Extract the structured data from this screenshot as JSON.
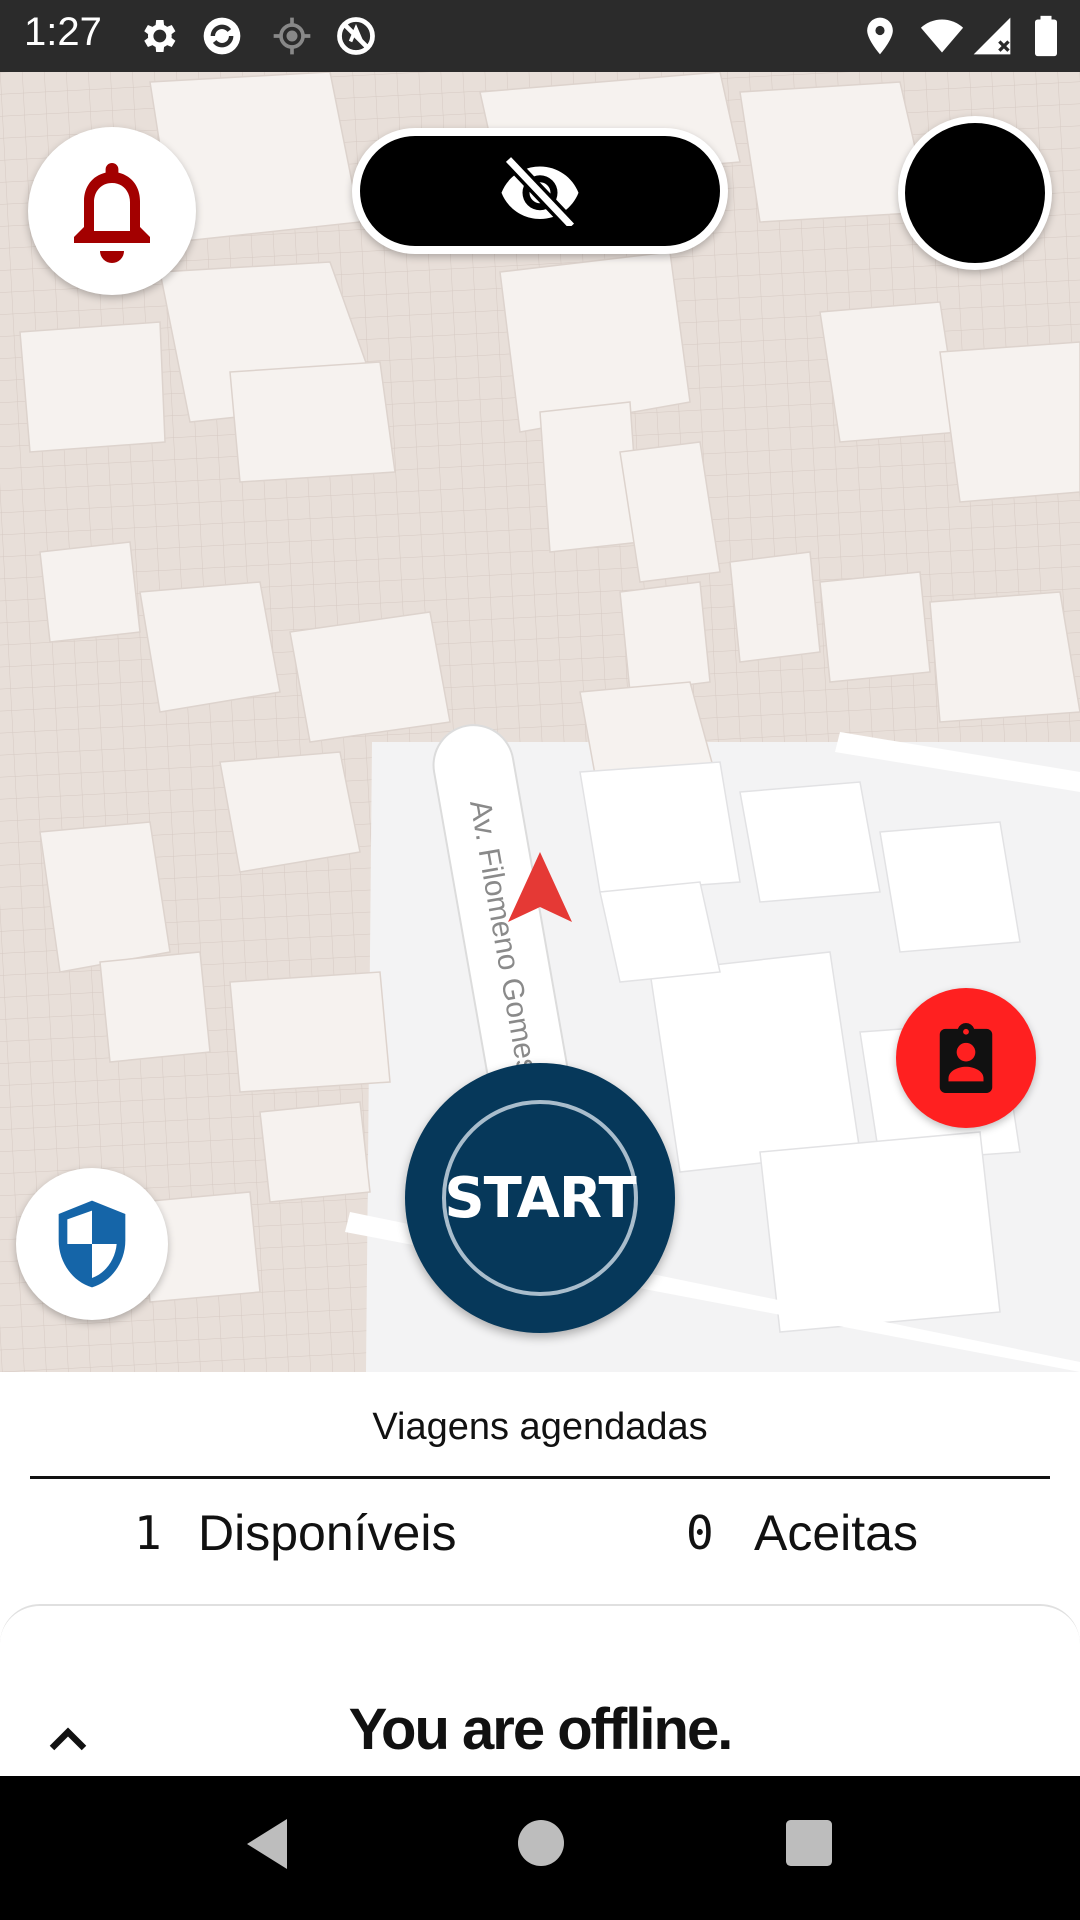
{
  "status_bar": {
    "time": "1:27",
    "icons_left": [
      "settings-icon",
      "sync-icon",
      "location-crosshair-icon",
      "no-ads-icon"
    ],
    "icons_right": [
      "location-pin-icon",
      "wifi-icon",
      "signal-icon",
      "battery-icon"
    ]
  },
  "map": {
    "street_label": "Av. Filomeno Gomes",
    "position_marker_color": "#e53935"
  },
  "top_controls": {
    "bell_icon": "bell-icon",
    "bell_color": "#a30000",
    "visibility_icon": "eye-off-icon",
    "avatar_icon": "avatar"
  },
  "start_button": {
    "label": "START",
    "color": "#06385a"
  },
  "report_button": {
    "icon": "clipboard-person-icon",
    "color": "#ff2020"
  },
  "shield_button": {
    "icon": "shield-icon",
    "color": "#1565a8"
  },
  "scheduled_trips": {
    "title": "Viagens agendadas",
    "available_count": "1",
    "available_label": "Disponíveis",
    "accepted_count": "0",
    "accepted_label": "Aceitas"
  },
  "offline_sheet": {
    "expand_icon": "chevron-up-icon",
    "status_text": "You are offline."
  },
  "nav_bar": {
    "back_icon": "back-icon",
    "home_icon": "home-icon",
    "recents_icon": "recents-icon"
  }
}
